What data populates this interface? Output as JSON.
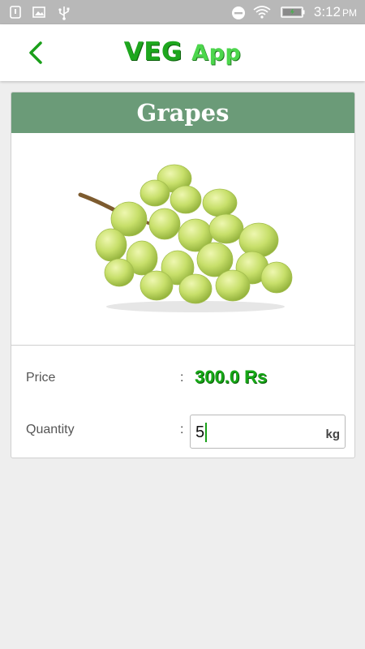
{
  "status_bar": {
    "time": "3:12",
    "ampm": "PM",
    "icons": [
      "notification-icon",
      "image-icon",
      "usb-icon",
      "do-not-disturb-icon",
      "wifi-icon",
      "battery-icon"
    ]
  },
  "app_bar": {
    "back_icon": "chevron-left-icon",
    "title_part1": "VEG",
    "title_part2": "App"
  },
  "product": {
    "name": "Grapes",
    "image": "grapes-image",
    "price_label": "Price",
    "colon": ":",
    "price_value": "300.0 Rs",
    "quantity_label": "Quantity",
    "quantity_value": "5",
    "quantity_unit": "kg"
  },
  "colors": {
    "status_bar": "#b8b8b8",
    "header_green": "#6b9b78",
    "brand_green": "#1ea71e",
    "price_green": "#16a816",
    "background": "#eeeeee"
  }
}
